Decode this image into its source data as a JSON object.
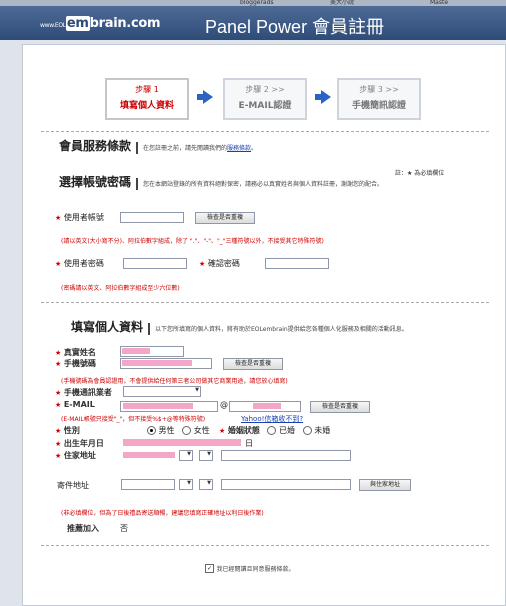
{
  "browser_tabs": [
    {
      "label": "bloggerads"
    },
    {
      "label": "美大小說"
    },
    {
      "label": "Maste"
    }
  ],
  "header": {
    "logo_prefix": "www.EOL",
    "logo_em": "em",
    "logo_suffix": "brain.com",
    "title": "Panel Power 會員註冊"
  },
  "steps": [
    {
      "num": "步驟 1",
      "title": "填寫個人資料"
    },
    {
      "num": "步驟 2 >>",
      "title": "E-MAIL認證"
    },
    {
      "num": "步驟 3 >>",
      "title": "手機簡訊認證"
    }
  ],
  "terms": {
    "title": "會員服務條款",
    "text": "在您註冊之前，請先閱讀我們的",
    "link": "服務條款",
    "end": "。"
  },
  "required_note": "註：★ 為必填欄位",
  "account": {
    "title": "選擇帳號密碼",
    "desc": "您在本網站登錄的所有資料絕對保密，請務必以真實姓名與個人資料註冊，謝謝您的配合。",
    "username_label": "使用者帳號",
    "check_button": "檢查是否重複",
    "username_hint": "(請以英文(大小寫不分)、阿拉伯數字組成，除了 \".\"、\"-\"、\"_\"三種符號以外，不接受其它特殊符號)",
    "password_label": "使用者密碼",
    "confirm_label": "確認密碼",
    "password_hint": "(密碼請以英文、阿拉伯數字組成至少六位數)"
  },
  "personal": {
    "title": "填寫個人資料",
    "desc": "以下您所填寫的個人資料，將有助於EOLembrain提供給您各種個人化服務及相關的活動訊息。",
    "name_label": "真實姓名",
    "mobile_label": "手機號碼",
    "mobile_check": "檢查是否重複",
    "mobile_hint": "(手機號碼為會員認證用，不會提供給任何第三者公司做其它商業用途，請您放心填寫)",
    "carrier_label": "手機通訊業者",
    "email_label": "E-MAIL",
    "email_at": "@",
    "email_check": "檢查是否重複",
    "email_hint": "(E-MAIL帳號只接受\"_\"，但不接受%$+@等特殊符號)",
    "yahoo_link": "Yahoo!信箱收不到?",
    "gender_label": "性別",
    "gender_male": "男性",
    "gender_female": "女性",
    "marital_label": "婚姻狀態",
    "marital_married": "已婚",
    "marital_single": "未婚",
    "birth_label": "出生年月日",
    "birth_value": "日",
    "address_label": "住家地址",
    "mail_label": "寄件地址",
    "same_button": "與住家地址",
    "address_hint": "(非必填欄位，但為了日後禮品寄送順暢，建議您填寫正確地址以利日後作業)",
    "referrer_label": "推薦加入",
    "referrer_value": "否"
  },
  "agree": {
    "text": "我已經閱讀且同意服務條款。"
  },
  "colors": {
    "header_bg": "#2e4c78",
    "accent_red": "#cc0000",
    "arrow_blue": "#2b63c4"
  }
}
